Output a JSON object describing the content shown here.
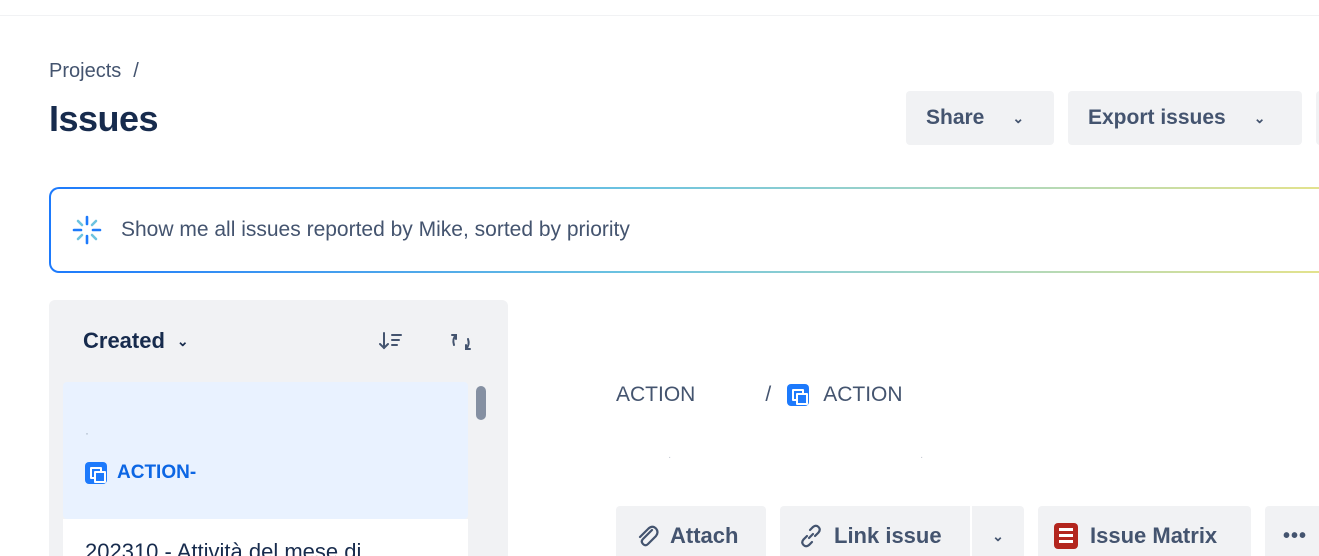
{
  "breadcrumb": {
    "root": "Projects",
    "separator": "/"
  },
  "page": {
    "title": "Issues"
  },
  "header_actions": {
    "share_label": "Share",
    "export_label": "Export issues"
  },
  "ai_search": {
    "query": "Show me all issues reported by Mike, sorted by priority",
    "icon": "ai-sparkle-icon"
  },
  "issue_list": {
    "sort_label": "Created",
    "items": [
      {
        "key": "ACTION-",
        "selected": true
      },
      {
        "title": "202310 - Attività del mese di"
      }
    ]
  },
  "detail": {
    "project_crumb": "ACTION",
    "separator": "/",
    "issue_crumb": "ACTION"
  },
  "detail_actions": {
    "attach_label": "Attach",
    "link_label": "Link issue",
    "matrix_label": "Issue Matrix",
    "more_label": "•••"
  },
  "colors": {
    "accent": "#0c66e4",
    "issue_type": "#1d7afc",
    "selected_bg": "#e9f2ff",
    "button_bg": "#f1f2f4",
    "matrix_icon": "#b3261e"
  }
}
